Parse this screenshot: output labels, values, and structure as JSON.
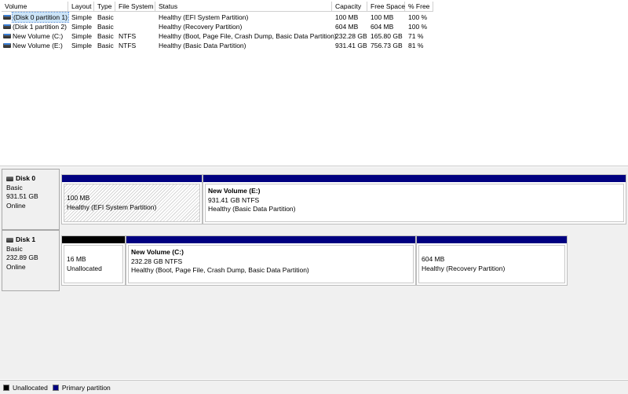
{
  "columns": [
    "Volume",
    "Layout",
    "Type",
    "File System",
    "Status",
    "Capacity",
    "Free Space",
    "% Free"
  ],
  "volumes": [
    {
      "name": "(Disk 0 partition 1)",
      "layout": "Simple",
      "type": "Basic",
      "fs": "",
      "status": "Healthy (EFI System Partition)",
      "capacity": "100 MB",
      "free": "100 MB",
      "pct": "100 %",
      "selected": true
    },
    {
      "name": "(Disk 1 partition 2)",
      "layout": "Simple",
      "type": "Basic",
      "fs": "",
      "status": "Healthy (Recovery Partition)",
      "capacity": "604 MB",
      "free": "604 MB",
      "pct": "100 %"
    },
    {
      "name": "New Volume (C:)",
      "layout": "Simple",
      "type": "Basic",
      "fs": "NTFS",
      "status": "Healthy (Boot, Page File, Crash Dump, Basic Data Partition)",
      "capacity": "232.28 GB",
      "free": "165.80 GB",
      "pct": "71 %"
    },
    {
      "name": "New Volume (E:)",
      "layout": "Simple",
      "type": "Basic",
      "fs": "NTFS",
      "status": "Healthy (Basic Data Partition)",
      "capacity": "931.41 GB",
      "free": "756.73 GB",
      "pct": "81 %"
    }
  ],
  "disks": [
    {
      "title": "Disk 0",
      "type": "Basic",
      "size": "931.51 GB",
      "state": "Online",
      "partitions": [
        {
          "name": "",
          "line1": "100 MB",
          "line2": "Healthy (EFI System Partition)",
          "kind": "primary"
        },
        {
          "name": "New Volume  (E:)",
          "line1": "931.41 GB NTFS",
          "line2": "Healthy (Basic Data Partition)",
          "kind": "primary"
        }
      ]
    },
    {
      "title": "Disk 1",
      "type": "Basic",
      "size": "232.89 GB",
      "state": "Online",
      "partitions": [
        {
          "name": "",
          "line1": "16 MB",
          "line2": "Unallocated",
          "kind": "unalloc"
        },
        {
          "name": "New Volume  (C:)",
          "line1": "232.28 GB NTFS",
          "line2": "Healthy (Boot, Page File, Crash Dump, Basic Data Partition)",
          "kind": "primary"
        },
        {
          "name": "",
          "line1": "604 MB",
          "line2": "Healthy (Recovery Partition)",
          "kind": "primary"
        }
      ]
    }
  ],
  "legend": {
    "unallocated": "Unallocated",
    "primary": "Primary partition"
  },
  "colors": {
    "primary": "#000080",
    "unallocated": "#000000"
  }
}
